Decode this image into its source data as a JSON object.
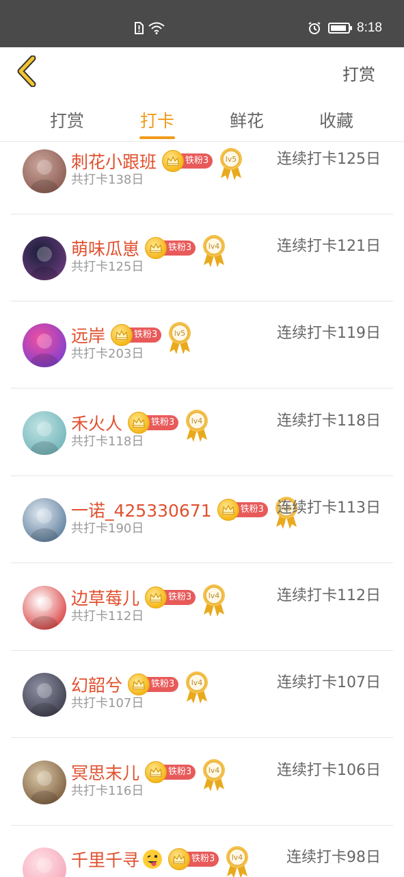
{
  "status_bar": {
    "time": "8:18"
  },
  "header": {
    "action_label": "打赏"
  },
  "tabs": [
    {
      "label": "打赏",
      "active": false
    },
    {
      "label": "打卡",
      "active": true
    },
    {
      "label": "鲜花",
      "active": false
    },
    {
      "label": "收藏",
      "active": false
    }
  ],
  "colors": {
    "accent": "#f29a1b",
    "name": "#e0502f",
    "fan_badge": "#e85a5a"
  },
  "rows": [
    {
      "name": "刺花小跟班",
      "fan_level": "铁粉3",
      "medal": "lv5",
      "total": "共打卡138日",
      "streak": "连续打卡125日"
    },
    {
      "name": "萌味瓜崽",
      "fan_level": "铁粉3",
      "medal": "lv4",
      "total": "共打卡125日",
      "streak": "连续打卡121日"
    },
    {
      "name": "远岸",
      "fan_level": "铁粉3",
      "medal": "lv5",
      "total": "共打卡203日",
      "streak": "连续打卡119日"
    },
    {
      "name": "禾火人",
      "fan_level": "铁粉3",
      "medal": "lv4",
      "total": "共打卡118日",
      "streak": "连续打卡118日"
    },
    {
      "name": "一诺_425330671",
      "fan_level": "铁粉3",
      "medal": "lv5",
      "total": "共打卡190日",
      "streak": "连续打卡113日"
    },
    {
      "name": "边草莓儿",
      "fan_level": "铁粉3",
      "medal": "lv4",
      "total": "共打卡112日",
      "streak": "连续打卡112日"
    },
    {
      "name": "幻韶兮",
      "fan_level": "铁粉3",
      "medal": "lv4",
      "total": "共打卡107日",
      "streak": "连续打卡107日"
    },
    {
      "name": "冥思末儿",
      "fan_level": "铁粉3",
      "medal": "lv4",
      "total": "共打卡116日",
      "streak": "连续打卡106日"
    },
    {
      "name": "千里千寻",
      "fan_level": "铁粉3",
      "medal": "lv4",
      "total": "",
      "streak": "连续打卡98日"
    }
  ]
}
